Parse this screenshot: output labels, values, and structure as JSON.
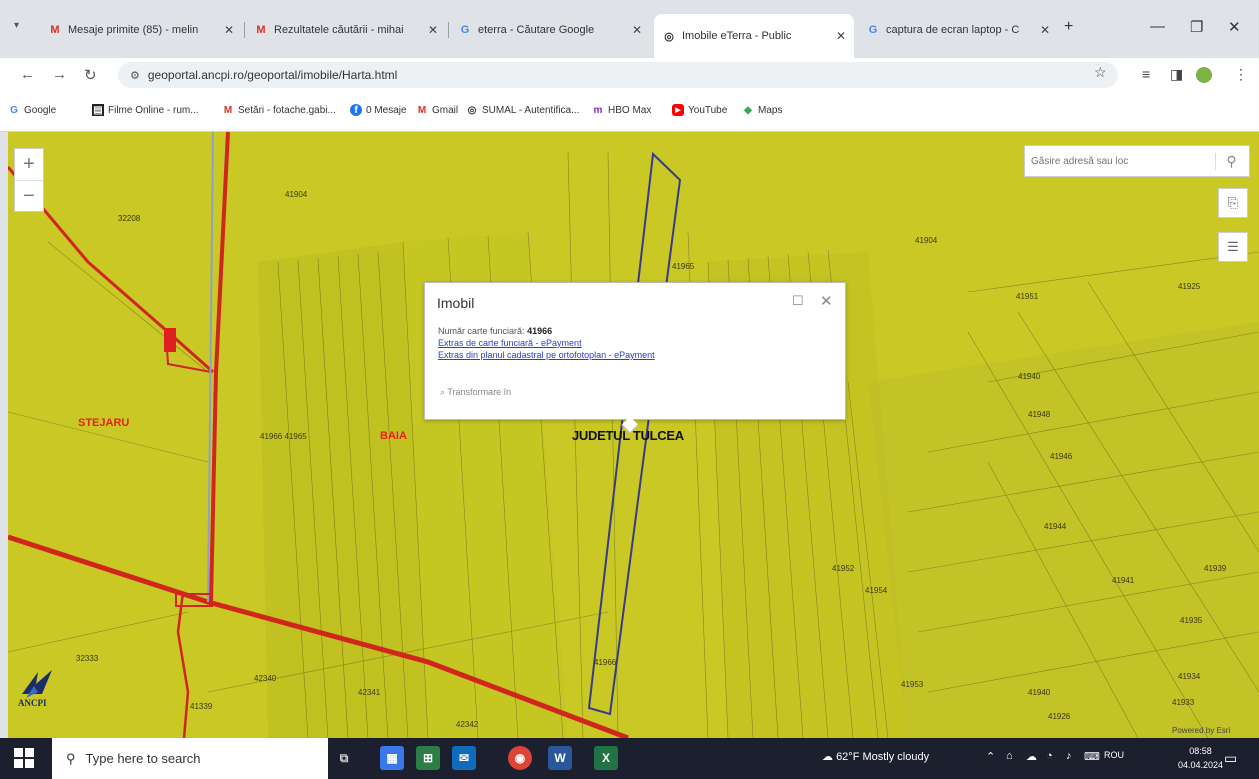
{
  "browser": {
    "tabs": [
      {
        "icon": "gmail-icon",
        "label": "Mesaje primite (85) - melin",
        "active": false
      },
      {
        "icon": "gmail-icon",
        "label": "Rezultatele căutării - mihai",
        "active": false
      },
      {
        "icon": "google-icon",
        "label": "eterra - Căutare Google",
        "active": false
      },
      {
        "icon": "ancpi-icon",
        "label": "Imobile eTerra - Public",
        "active": true
      },
      {
        "icon": "google-icon",
        "label": "captura de ecran laptop - C",
        "active": false
      }
    ],
    "new_tab": "+",
    "url": "geoportal.ancpi.ro/geoportal/imobile/Harta.html",
    "bookmarks": [
      {
        "icon": "google-icon",
        "label": "Google"
      },
      {
        "icon": "film-icon",
        "label": "Filme Online - rum..."
      },
      {
        "icon": "gmail-icon",
        "label": "Setări - fotache.gabi..."
      },
      {
        "icon": "messenger-icon",
        "label": "0 Mesaje"
      },
      {
        "icon": "gmail-icon",
        "label": "Gmail"
      },
      {
        "icon": "sumal-icon",
        "label": "SUMAL - Autentifica..."
      },
      {
        "icon": "hbo-icon",
        "label": "HBO Max"
      },
      {
        "icon": "youtube-icon",
        "label": "YouTube"
      },
      {
        "icon": "maps-icon",
        "label": "Maps"
      }
    ]
  },
  "map": {
    "search_placeholder": "Găsire adresă sau loc",
    "zoom_in": "+",
    "zoom_out": "−",
    "places": {
      "stejaru": "STEJARU",
      "baia": "BAIA"
    },
    "county_label": "JUDETUL TULCEA",
    "parcel_labels": [
      "41904",
      "32208",
      "41965",
      "41904",
      "41951",
      "41925",
      "41940",
      "41946",
      "41948",
      "41944",
      "41952",
      "41954",
      "41941",
      "41939",
      "41966 41965",
      "41966",
      "32333",
      "42340",
      "42341",
      "42342",
      "41339",
      "41953",
      "41940",
      "41926",
      "41935",
      "41934",
      "41933"
    ],
    "logo_text": "ANCPI",
    "powered_by": "Powered by Esri"
  },
  "popup": {
    "title": "Imobil",
    "field_label": "Număr carte funciară:",
    "field_value": "41966",
    "link1": "Extras de carte funciară - ePayment",
    "link2": "Extras din planul cadastral pe ortofotoplan - ePayment",
    "transform": "Transformare în"
  },
  "taskbar": {
    "search_placeholder": "Type here to search",
    "weather": "62°F  Mostly cloudy",
    "language": "ROU",
    "time": "08:58",
    "date": "04.04.2024"
  },
  "colors": {
    "map_fill": "#c9c825",
    "road": "#d0261e",
    "parcel_outline": "#3a3a8c",
    "link": "#2a3bd6"
  }
}
